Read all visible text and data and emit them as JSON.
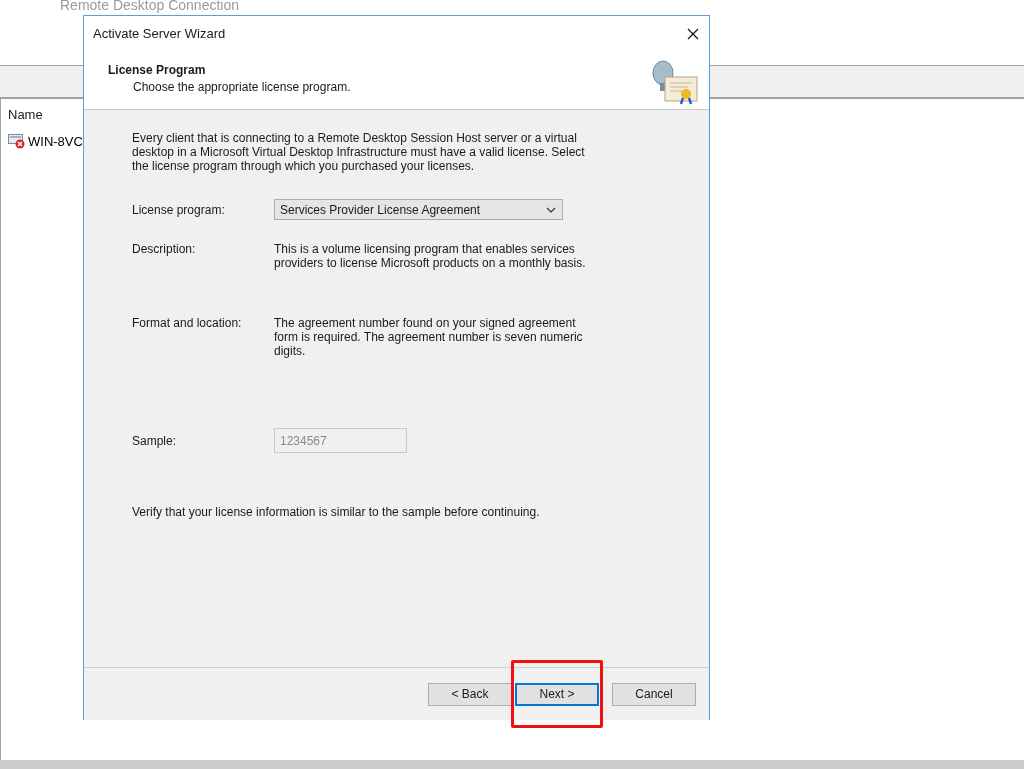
{
  "background_window": {
    "title": "Remote Desktop Connection",
    "column_header": "Name",
    "items": [
      {
        "label": "WIN-8VC"
      }
    ]
  },
  "dialog": {
    "title": "Activate Server Wizard",
    "heading": "License Program",
    "subheading": "Choose the appropriate license program.",
    "intro": "Every client that is connecting to a Remote Desktop Session Host server or a virtual desktop in a Microsoft Virtual Desktop Infrastructure must have a valid license. Select the license program through which you purchased your licenses.",
    "fields": [
      {
        "kind": "dropdown",
        "label": "License program:",
        "value": "Services Provider License Agreement"
      },
      {
        "kind": "text",
        "label": "Description:",
        "value": "This is a volume licensing program that enables services providers to license Microsoft products on a monthly basis."
      },
      {
        "kind": "text",
        "label": "Format and location:",
        "value": "The agreement number found on your signed agreement form is required. The agreement number is seven numeric digits."
      },
      {
        "kind": "input",
        "label": "Sample:",
        "value": "1234567",
        "disabled": true
      }
    ],
    "note": "Verify that your license information is similar to the sample before continuing.",
    "buttons": [
      {
        "label": "< Back",
        "default": false,
        "highlighted": false
      },
      {
        "label": "Next >",
        "default": true,
        "highlighted": true
      },
      {
        "label": "Cancel",
        "default": false,
        "highlighted": false
      }
    ]
  }
}
